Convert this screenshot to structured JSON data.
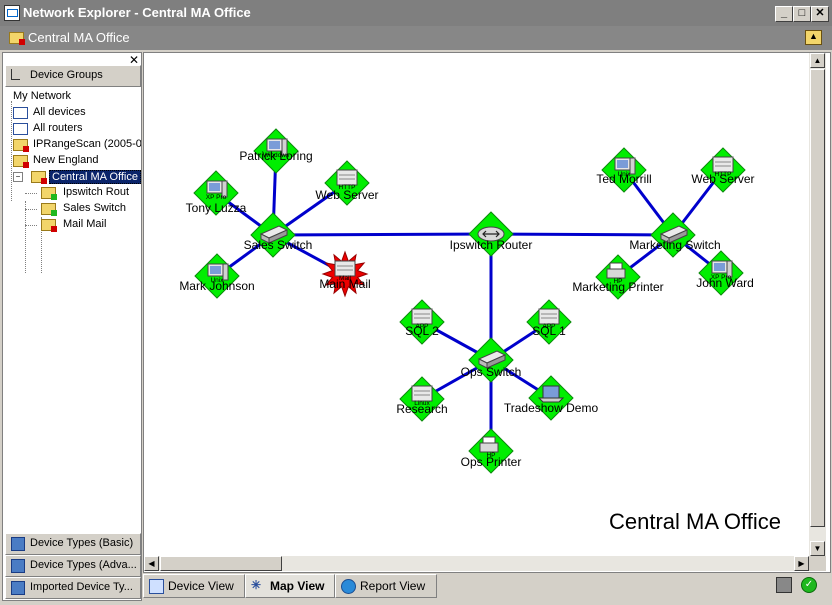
{
  "window": {
    "title": "Network Explorer - Central MA Office",
    "minimize": "_",
    "maximize": "□",
    "close": "✕"
  },
  "location": {
    "title": "Central MA Office"
  },
  "leftpanel": {
    "close": "✕",
    "device_groups_label": "Device Groups",
    "tree": [
      {
        "label": "My Network"
      },
      {
        "label": "All devices"
      },
      {
        "label": "All routers"
      },
      {
        "label": "IPRangeScan (2005-0"
      },
      {
        "label": "New England"
      },
      {
        "label": "Central MA Office"
      },
      {
        "label": "Ipswitch Rout"
      },
      {
        "label": "Sales Switch"
      },
      {
        "label": "Mail Mail"
      }
    ],
    "bottom_tabs": [
      {
        "label": "Device Types (Basic)"
      },
      {
        "label": "Device Types (Adva..."
      },
      {
        "label": "Imported Device Ty..."
      }
    ]
  },
  "views": {
    "device_view": "Device View",
    "map_view": "Map View",
    "report_view": "Report View"
  },
  "map": {
    "caption": "Central MA Office",
    "nodes": [
      {
        "id": "sales_switch",
        "label": "Sales Switch",
        "type": "switch",
        "badge": "",
        "status": "up"
      },
      {
        "id": "patrick",
        "label": "Patrick Loring",
        "type": "desktop",
        "badge": "Windows",
        "status": "up"
      },
      {
        "id": "tony",
        "label": "Tony Luzza",
        "type": "desktop",
        "badge": "XP Pro",
        "status": "up"
      },
      {
        "id": "web_left",
        "label": "Web Server",
        "type": "server",
        "badge": "HTTP",
        "status": "up"
      },
      {
        "id": "mark",
        "label": "Mark Johnson",
        "type": "desktop",
        "badge": "Unix",
        "status": "up"
      },
      {
        "id": "main_mail",
        "label": "Main Mail",
        "type": "server",
        "badge": "Mail",
        "status": "down"
      },
      {
        "id": "router",
        "label": "Ipswitch Router",
        "type": "router",
        "badge": "",
        "status": "up"
      },
      {
        "id": "marketing_switch",
        "label": "Marketing Switch",
        "type": "switch",
        "badge": "",
        "status": "up"
      },
      {
        "id": "ted",
        "label": "Ted Morrill",
        "type": "desktop",
        "badge": "Unix",
        "status": "up"
      },
      {
        "id": "web_right",
        "label": "Web Server",
        "type": "server",
        "badge": "HTTP",
        "status": "up"
      },
      {
        "id": "mkt_printer",
        "label": "Marketing Printer",
        "type": "printer",
        "badge": "HP",
        "status": "up"
      },
      {
        "id": "john",
        "label": "John Ward",
        "type": "desktop",
        "badge": "XP Pro",
        "status": "up"
      },
      {
        "id": "ops_switch",
        "label": "Ops Switch",
        "type": "switch",
        "badge": "",
        "status": "up"
      },
      {
        "id": "sql2",
        "label": "SQL 2",
        "type": "server",
        "badge": "APP",
        "status": "up"
      },
      {
        "id": "sql1",
        "label": "SQL 1",
        "type": "server",
        "badge": "APP",
        "status": "up"
      },
      {
        "id": "research",
        "label": "Research",
        "type": "server",
        "badge": "Linux",
        "status": "up"
      },
      {
        "id": "tradeshow",
        "label": "Tradeshow Demo",
        "type": "laptop",
        "badge": "",
        "status": "up"
      },
      {
        "id": "ops_printer",
        "label": "Ops Printer",
        "type": "printer",
        "badge": "HP",
        "status": "up"
      }
    ],
    "links": [
      [
        "sales_switch",
        "patrick"
      ],
      [
        "sales_switch",
        "tony"
      ],
      [
        "sales_switch",
        "web_left"
      ],
      [
        "sales_switch",
        "mark"
      ],
      [
        "sales_switch",
        "main_mail"
      ],
      [
        "sales_switch",
        "router"
      ],
      [
        "router",
        "marketing_switch"
      ],
      [
        "router",
        "ops_switch"
      ],
      [
        "marketing_switch",
        "ted"
      ],
      [
        "marketing_switch",
        "web_right"
      ],
      [
        "marketing_switch",
        "mkt_printer"
      ],
      [
        "marketing_switch",
        "john"
      ],
      [
        "ops_switch",
        "sql2"
      ],
      [
        "ops_switch",
        "sql1"
      ],
      [
        "ops_switch",
        "research"
      ],
      [
        "ops_switch",
        "tradeshow"
      ],
      [
        "ops_switch",
        "ops_printer"
      ]
    ]
  },
  "colors": {
    "link": "#0000cc",
    "node_up": "#00ee00",
    "node_down": "#ee0000"
  }
}
